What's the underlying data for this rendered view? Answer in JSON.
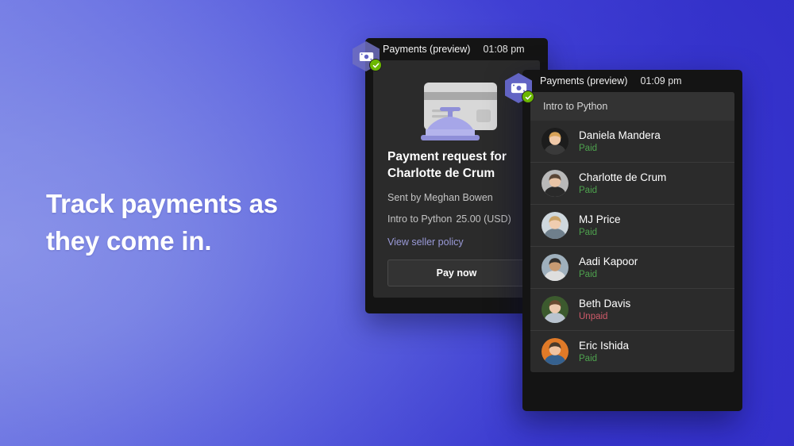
{
  "background": {
    "gradient_from": "#8a93e8",
    "gradient_to": "#3531c8"
  },
  "headline": {
    "line1": "Track payments as",
    "line2": "they come in."
  },
  "request_window": {
    "app_icon": "money-bill-icon",
    "status_icon": "green-check-icon",
    "title": "Payments (preview)",
    "time": "01:08 pm",
    "illustration": "credit-card-and-service-bell-illustration",
    "heading": "Payment request for Charlotte de Crum",
    "sent_by": "Sent by Meghan Bowen",
    "item_label": "Intro to Python",
    "amount": "25.00 (USD)",
    "policy_link": "View seller policy",
    "pay_button": "Pay now"
  },
  "list_window": {
    "app_icon": "money-bill-icon",
    "status_icon": "green-check-icon",
    "title": "Payments (preview)",
    "time": "01:09 pm",
    "list_header": "Intro to Python",
    "rows": [
      {
        "name": "Daniela Mandera",
        "status": "Paid",
        "status_type": "paid",
        "avatar": "avatar-daniela-mandera"
      },
      {
        "name": "Charlotte de Crum",
        "status": "Paid",
        "status_type": "paid",
        "avatar": "avatar-charlotte-de-crum"
      },
      {
        "name": "MJ Price",
        "status": "Paid",
        "status_type": "paid",
        "avatar": "avatar-mj-price"
      },
      {
        "name": "Aadi Kapoor",
        "status": "Paid",
        "status_type": "paid",
        "avatar": "avatar-aadi-kapoor"
      },
      {
        "name": "Beth Davis",
        "status": "Unpaid",
        "status_type": "unpaid",
        "avatar": "avatar-beth-davis"
      },
      {
        "name": "Eric Ishida",
        "status": "Paid",
        "status_type": "paid",
        "avatar": "avatar-eric-ishida"
      }
    ]
  },
  "colors": {
    "paid": "#4ea24e",
    "unpaid": "#d05b6a",
    "link": "#9a9ad8",
    "badge_purple": "#6264c4",
    "check_green": "#6bb700",
    "card_surface": "#2b2b2b",
    "window_frame": "#141414"
  }
}
